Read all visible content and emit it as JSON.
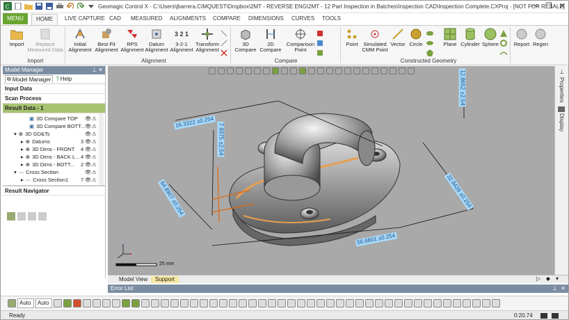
{
  "window": {
    "title": "Geomagic Control X - C:\\Users\\jbarrera.CIMQUEST\\Dropbox\\2MT - REVERSE ENG\\2MT - 12 Part Inspection in Batches\\Inspection CAD\\Inspection Complete.CXProj - [NOT FOR RESALE]"
  },
  "tabs": [
    "MENU",
    "HOME",
    "LIVE CAPTURE",
    "CAD",
    "MEASURED",
    "ALIGNMENTS",
    "COMPARE",
    "DIMENSIONS",
    "CURVES",
    "TOOLS"
  ],
  "ribbon": {
    "import": {
      "label": "Import"
    },
    "replace": {
      "label": "Replace Measured Data"
    },
    "initial": {
      "label": "Initial Alignment"
    },
    "bestfit": {
      "label": "Best Fit Alignment"
    },
    "rps": {
      "label": "RPS Alignment"
    },
    "datum": {
      "label": "Datum Alignment"
    },
    "three21": {
      "label": "3-2-1 Alignment",
      "icon_text": "3 2 1"
    },
    "transform": {
      "label": "Transform Alignment"
    },
    "compare3d": {
      "label": "3D Compare"
    },
    "compare2d": {
      "label": "2D Compare"
    },
    "comparisonpoint": {
      "label": "Comparison Point"
    },
    "point": {
      "label": "Point"
    },
    "simcmm": {
      "label": "Simulated CMM Point"
    },
    "vector": {
      "label": "Vector"
    },
    "circle": {
      "label": "Circle"
    },
    "plane": {
      "label": "Plane"
    },
    "cylinder": {
      "label": "Cylinder"
    },
    "sphere": {
      "label": "Sphere"
    },
    "report": {
      "label": "Report"
    },
    "regen": {
      "label": "Regen"
    },
    "groups": {
      "import": "Import",
      "alignment": "Alignment",
      "compare": "Compare",
      "constructed": "Constructed Geometry"
    }
  },
  "panel": {
    "title": "Model Manager",
    "tab_model": "Model Manager",
    "tab_help": "Help",
    "input_data": "Input Data",
    "scan_process": "Scan Process",
    "result_data": "Result Data - 1",
    "result_navigator": "Result Navigator",
    "tree": [
      {
        "label": "3D Compare TOP",
        "count": ""
      },
      {
        "label": "3D Compare BOTT...",
        "count": ""
      },
      {
        "label": "3D GD&Ts",
        "count": ""
      },
      {
        "label": "Datums",
        "count": "3"
      },
      {
        "label": "3D Dims - FRONT",
        "count": "4"
      },
      {
        "label": "3D Dims - BACK L...",
        "count": "4"
      },
      {
        "label": "3D Dims - BOTT...",
        "count": "2"
      },
      {
        "label": "Cross Section",
        "count": ""
      },
      {
        "label": "Cross Section1",
        "count": "7"
      }
    ]
  },
  "viewport": {
    "dims": [
      {
        "value": "16.3322",
        "tol": "±0.254"
      },
      {
        "value": "7.9375",
        "tol": "±2.54"
      },
      {
        "value": "12.8652",
        "tol": "±2.54"
      },
      {
        "value": "64.8907",
        "tol": "±0.254"
      },
      {
        "value": "32.8428",
        "tol": "±0.254"
      },
      {
        "value": "56.6801",
        "tol": "±0.254"
      }
    ],
    "scale": "25 mm"
  },
  "right_strip": {
    "properties": "Properties",
    "display": "Display"
  },
  "bottom": {
    "tab_model_view": "Model View",
    "tab_support": "Support",
    "error_list": "Error List",
    "auto1": "Auto",
    "auto2": "Auto"
  },
  "status": {
    "ready": "Ready",
    "time": "0:20.74"
  },
  "colors": {
    "accent": "#6aa531",
    "panel_header": "#7b8da2",
    "viewport": "#a9a9a9",
    "dim_label": "#a8d8f8"
  }
}
